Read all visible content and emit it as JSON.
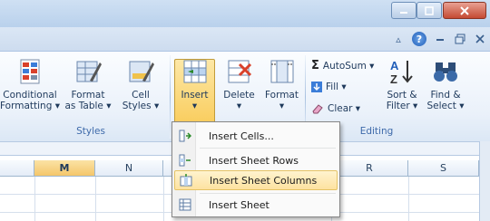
{
  "ribbon": {
    "styles_group": {
      "label": "Styles",
      "conditional_formatting": {
        "line1": "Conditional",
        "line2": "Formatting ▾"
      },
      "format_as_table": {
        "line1": "Format",
        "line2": "as Table ▾"
      },
      "cell_styles": {
        "line1": "Cell",
        "line2": "Styles ▾"
      }
    },
    "cells_group": {
      "insert": {
        "line1": "Insert",
        "line2": "▾"
      },
      "delete": {
        "line1": "Delete",
        "line2": "▾"
      },
      "format": {
        "line1": "Format",
        "line2": "▾"
      }
    },
    "editing_group": {
      "label": "Editing",
      "autosum": "AutoSum ▾",
      "autosum_symbol": "Σ",
      "fill": "Fill ▾",
      "clear": "Clear ▾",
      "sort_filter": {
        "line1": "Sort &",
        "line2": "Filter ▾"
      },
      "find_select": {
        "line1": "Find &",
        "line2": "Select ▾"
      }
    }
  },
  "tab_icons": {
    "help": "?",
    "caret": "▵"
  },
  "insert_menu": {
    "items": [
      {
        "label": "Insert Cells...",
        "icon": "insert-cells-icon",
        "highlighted": false
      },
      {
        "label": "Insert Sheet Rows",
        "icon": "insert-rows-icon",
        "highlighted": false
      },
      {
        "label": "Insert Sheet Columns",
        "icon": "insert-columns-icon",
        "highlighted": true
      },
      {
        "label": "Insert Sheet",
        "icon": "insert-sheet-icon",
        "highlighted": false
      }
    ]
  },
  "grid": {
    "columns": [
      "M",
      "N",
      "",
      "",
      "R",
      "S"
    ],
    "selected_column": "M"
  },
  "colors": {
    "highlight": "#fde2a0",
    "ribbon": "#eaf1fa",
    "close_button": "#c44a33"
  }
}
